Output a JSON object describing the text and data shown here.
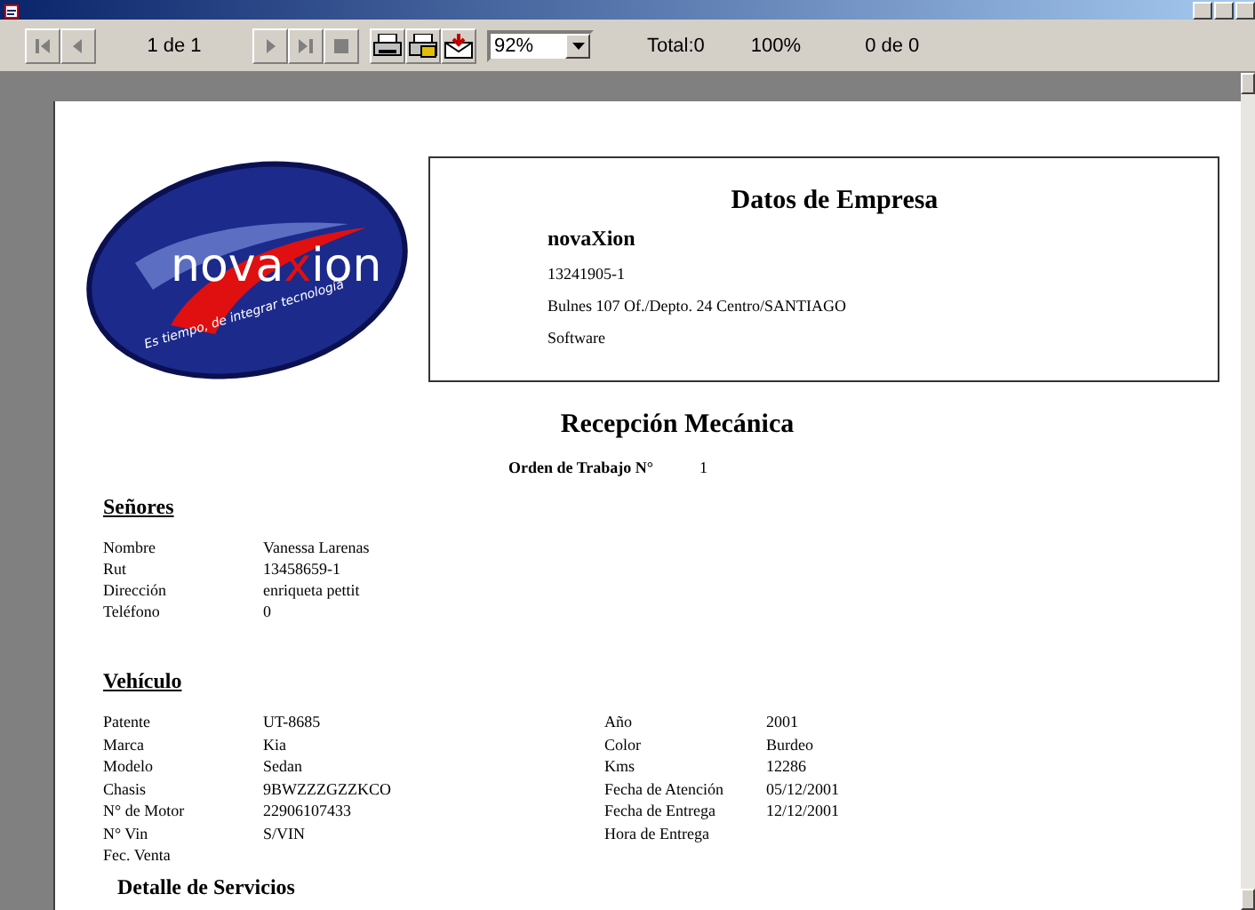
{
  "toolbar": {
    "nav_buttons": [
      {
        "kind": "first",
        "disabled": true
      },
      {
        "kind": "prev",
        "disabled": true
      }
    ],
    "page_indicator": "1 de 1",
    "nav_buttons_2": [
      {
        "kind": "next",
        "disabled": true
      },
      {
        "kind": "last",
        "disabled": true
      },
      {
        "kind": "stop",
        "disabled": true
      }
    ],
    "tool_buttons": [
      {
        "kind": "print"
      },
      {
        "kind": "print-setup"
      },
      {
        "kind": "export"
      }
    ],
    "zoom": {
      "value": "92%"
    },
    "total": "Total:0",
    "percent": "100%",
    "found": "0 de 0"
  },
  "report": {
    "logo": {
      "wordmark_left": "nova",
      "wordmark_x": "x",
      "wordmark_right": "ion",
      "tagline": "Es tiempo, de integrar tecnología"
    },
    "company": {
      "heading": "Datos de Empresa",
      "name": "novaXion",
      "rut": "13241905-1",
      "address": "Bulnes 107 Of./Depto. 24 Centro/SANTIAGO",
      "line": "Software"
    },
    "title": "Recepción  Mecánica",
    "order": {
      "label": "Orden de Trabajo N°",
      "value": "1"
    },
    "client": {
      "heading": "Señores",
      "rows": [
        {
          "label": "Nombre",
          "value": "Vanessa Larenas"
        },
        {
          "label": "Rut",
          "value": "13458659-1"
        },
        {
          "label": "Dirección",
          "value": "enriqueta pettit"
        },
        {
          "label": "Teléfono",
          "value": "0"
        }
      ]
    },
    "vehicle": {
      "heading": "Vehículo",
      "left": [
        {
          "label": "Patente",
          "value": "UT-8685"
        },
        {
          "label": "Marca",
          "value": "Kia"
        },
        {
          "label": "Modelo",
          "value": "Sedan"
        },
        {
          "label": "Chasis",
          "value": "9BWZZZGZZKCO"
        },
        {
          "label": "N° de Motor",
          "value": "22906107433"
        },
        {
          "label": "N° Vin",
          "value": "S/VIN"
        },
        {
          "label": "Fec. Venta"
        }
      ],
      "right": [
        {
          "label": "Año",
          "value": "2001"
        },
        {
          "label": "Color",
          "value": "Burdeo"
        },
        {
          "label": "Kms",
          "value": "12286"
        },
        {
          "label": "Fecha de Atención",
          "value": "05/12/2001"
        },
        {
          "label": "Fecha de Entrega",
          "value": "12/12/2001"
        },
        {
          "label": "Hora de Entrega"
        }
      ]
    },
    "next_heading": "Detalle de Servicios"
  }
}
